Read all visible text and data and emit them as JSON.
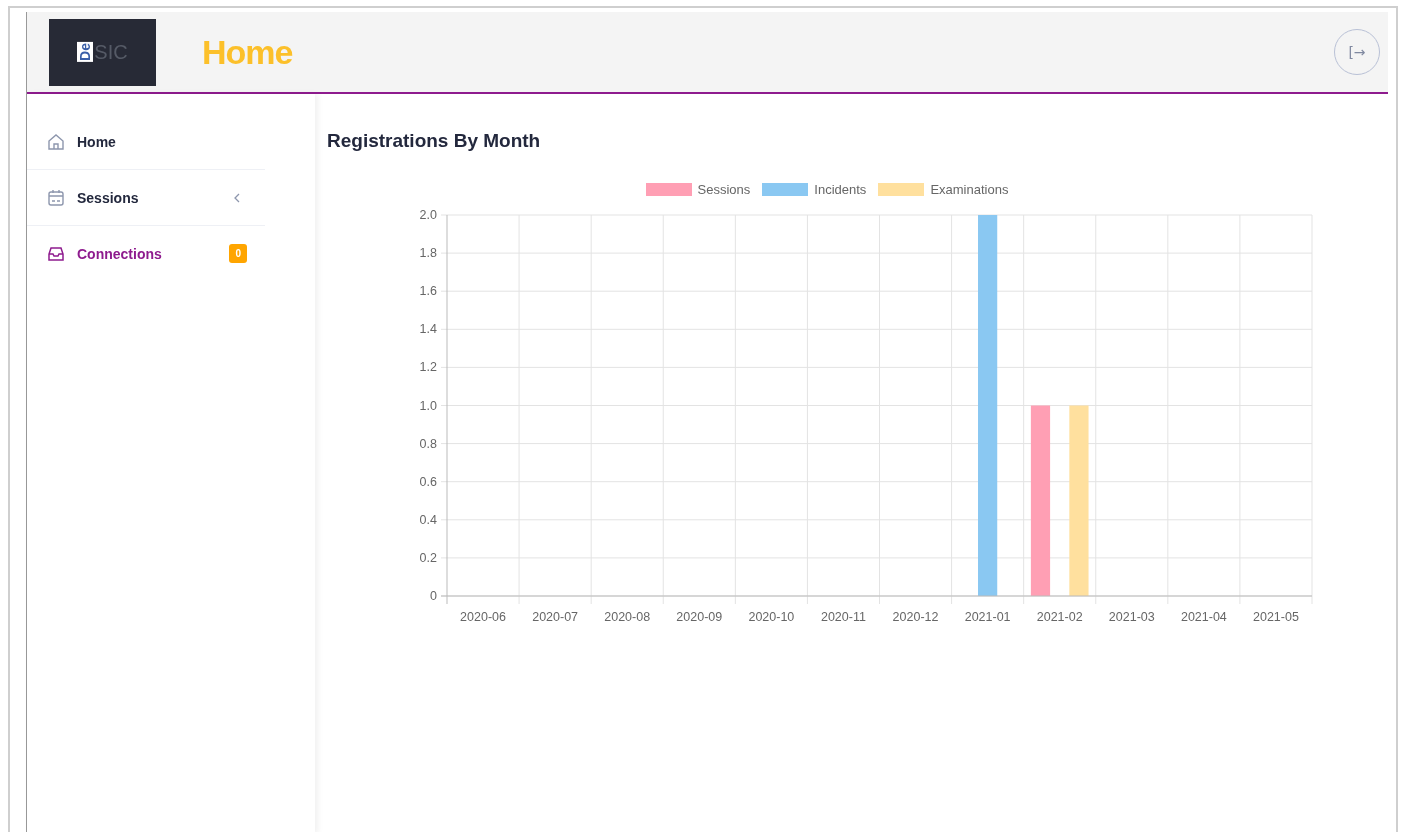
{
  "header": {
    "logo": {
      "mark": "De",
      "text": "SIC"
    },
    "title": "Home",
    "logout_icon": "[→"
  },
  "sidebar": {
    "items": [
      {
        "label": "Home",
        "kind": "home",
        "selected": false
      },
      {
        "label": "Sessions",
        "kind": "calendar",
        "selected": false,
        "expandable": true
      },
      {
        "label": "Connections",
        "kind": "inbox",
        "selected": true,
        "badge": "0"
      }
    ]
  },
  "content": {
    "title": "Registrations By Month",
    "chart_data": {
      "type": "bar",
      "grid": true,
      "legend": "top",
      "categories": [
        "2020-06",
        "2020-07",
        "2020-08",
        "2020-09",
        "2020-10",
        "2020-11",
        "2020-12",
        "2021-01",
        "2021-02",
        "2021-03",
        "2021-04",
        "2021-05"
      ],
      "series": [
        {
          "name": "Sessions",
          "color": "#ff9fb4",
          "values": [
            0,
            0,
            0,
            0,
            0,
            0,
            0,
            0,
            1,
            0,
            0,
            0
          ]
        },
        {
          "name": "Incidents",
          "color": "#8ac8f2",
          "values": [
            0,
            0,
            0,
            0,
            0,
            0,
            0,
            2,
            0,
            0,
            0,
            0
          ]
        },
        {
          "name": "Examinations",
          "color": "#ffe09e",
          "values": [
            0,
            0,
            0,
            0,
            0,
            0,
            0,
            0,
            1,
            0,
            0,
            0
          ]
        }
      ],
      "ylim": [
        0,
        2
      ],
      "yticks": [
        0,
        {
          "value": 0.2,
          "label": "0.2"
        },
        {
          "value": 0.4,
          "label": "0.4"
        },
        {
          "value": 0.6,
          "label": "0.6"
        },
        {
          "value": 0.8,
          "label": "0.8"
        },
        {
          "value": 1,
          "label": "1.0"
        },
        {
          "value": 1.2,
          "label": "1.2"
        },
        {
          "value": 1.4,
          "label": "1.4"
        },
        {
          "value": 1.6,
          "label": "1.6"
        },
        {
          "value": 1.8,
          "label": "1.8"
        },
        {
          "value": 2,
          "label": "2.0"
        }
      ]
    }
  }
}
